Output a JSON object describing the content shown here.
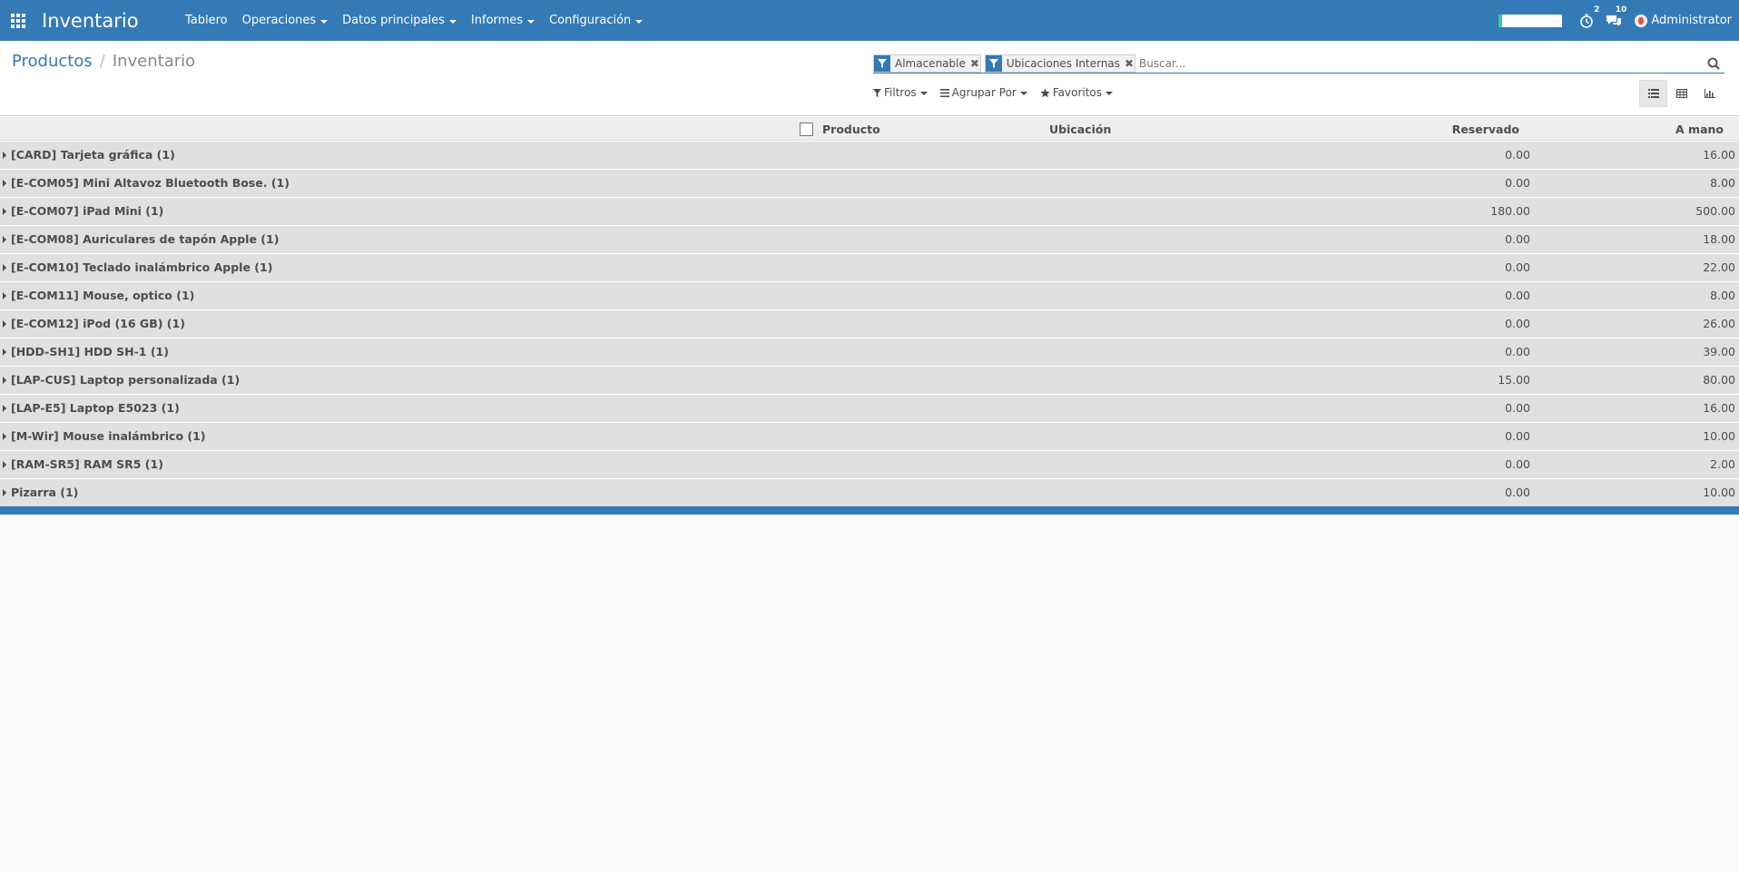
{
  "navbar": {
    "app_title": "Inventario",
    "menu": [
      {
        "label": "Tablero",
        "dropdown": false
      },
      {
        "label": "Operaciones",
        "dropdown": true
      },
      {
        "label": "Datos principales",
        "dropdown": true
      },
      {
        "label": "Informes",
        "dropdown": true
      },
      {
        "label": "Configuración",
        "dropdown": true
      }
    ],
    "activity_count": "2",
    "messages_count": "10",
    "user_name": "Administrator"
  },
  "breadcrumb": {
    "parent": "Productos",
    "current": "Inventario"
  },
  "search": {
    "facets": [
      "Almacenable",
      "Ubicaciones Internas"
    ],
    "placeholder": "Buscar..."
  },
  "filters": {
    "filters_label": "Filtros",
    "group_by_label": "Agrupar Por",
    "favorites_label": "Favoritos"
  },
  "table": {
    "headers": {
      "product": "Producto",
      "location": "Ubicación",
      "reserved": "Reservado",
      "on_hand": "A mano"
    },
    "groups": [
      {
        "name": "[CARD] Tarjeta gráfica (1)",
        "reserved": "0.00",
        "on_hand": "16.00"
      },
      {
        "name": "[E-COM05] Mini Altavoz Bluetooth Bose. (1)",
        "reserved": "0.00",
        "on_hand": "8.00"
      },
      {
        "name": "[E-COM07] iPad Mini (1)",
        "reserved": "180.00",
        "on_hand": "500.00"
      },
      {
        "name": "[E-COM08] Auriculares de tapón Apple (1)",
        "reserved": "0.00",
        "on_hand": "18.00"
      },
      {
        "name": "[E-COM10] Teclado inalámbrico Apple (1)",
        "reserved": "0.00",
        "on_hand": "22.00"
      },
      {
        "name": "[E-COM11] Mouse, optico (1)",
        "reserved": "0.00",
        "on_hand": "8.00"
      },
      {
        "name": "[E-COM12] iPod (16 GB) (1)",
        "reserved": "0.00",
        "on_hand": "26.00"
      },
      {
        "name": "[HDD-SH1] HDD SH-1 (1)",
        "reserved": "0.00",
        "on_hand": "39.00"
      },
      {
        "name": "[LAP-CUS] Laptop personalizada (1)",
        "reserved": "15.00",
        "on_hand": "80.00"
      },
      {
        "name": "[LAP-E5] Laptop E5023 (1)",
        "reserved": "0.00",
        "on_hand": "16.00"
      },
      {
        "name": "[M-Wir] Mouse inalámbrico (1)",
        "reserved": "0.00",
        "on_hand": "10.00"
      },
      {
        "name": "[RAM-SR5] RAM SR5 (1)",
        "reserved": "0.00",
        "on_hand": "2.00"
      },
      {
        "name": "Pizarra (1)",
        "reserved": "0.00",
        "on_hand": "10.00"
      }
    ]
  }
}
